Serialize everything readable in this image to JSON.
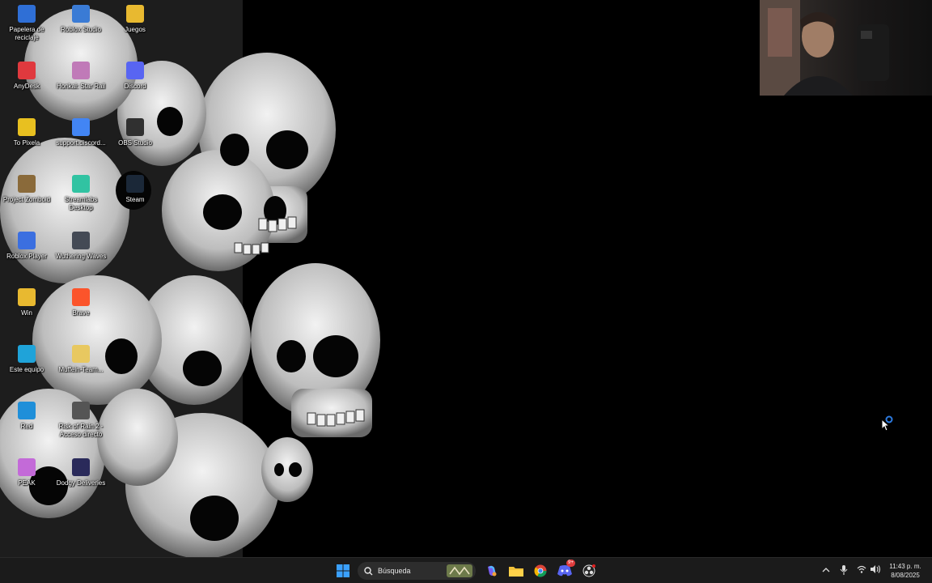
{
  "desktop": {
    "icons": [
      {
        "label": "Papelera de reciclaje",
        "icon": "recycle-bin-icon",
        "color": "#2f6fd6"
      },
      {
        "label": "Roblox Studio",
        "icon": "roblox-studio-icon",
        "color": "#3a7bd5"
      },
      {
        "label": "Juegos",
        "icon": "folder-icon",
        "color": "#e8b930"
      },
      {
        "label": "AnyDesk",
        "icon": "anydesk-icon",
        "color": "#e0393e"
      },
      {
        "label": "Honkai: Star Rail",
        "icon": "honkai-star-rail-icon",
        "color": "#c07ab8"
      },
      {
        "label": "Discord",
        "icon": "discord-icon",
        "color": "#5865f2"
      },
      {
        "label": "To Pixela",
        "icon": "to-pixela-icon",
        "color": "#e8c020"
      },
      {
        "label": "support.discord...",
        "icon": "chrome-shortcut-icon",
        "color": "#4285f4"
      },
      {
        "label": "OBS Studio",
        "icon": "obs-studio-icon",
        "color": "#303030"
      },
      {
        "label": "Project Zomboid",
        "icon": "project-zomboid-icon",
        "color": "#8a6a3a"
      },
      {
        "label": "Streamlabs Desktop",
        "icon": "streamlabs-icon",
        "color": "#31c3a2"
      },
      {
        "label": "Steam",
        "icon": "steam-icon",
        "color": "#1b2838"
      },
      {
        "label": "Roblox Player",
        "icon": "roblox-player-icon",
        "color": "#3b6fe0"
      },
      {
        "label": "Wuthering Waves",
        "icon": "wuthering-waves-icon",
        "color": "#444a55"
      },
      {
        "label": "Win",
        "icon": "folder-icon",
        "color": "#e8b930"
      },
      {
        "label": "Brave",
        "icon": "brave-icon",
        "color": "#fb542b"
      },
      {
        "label": "Este equipo",
        "icon": "this-pc-icon",
        "color": "#1fa3d9"
      },
      {
        "label": "Muffein-Team...",
        "icon": "folder-icon",
        "color": "#e8c860"
      },
      {
        "label": "Red",
        "icon": "network-icon",
        "color": "#1f8fd9"
      },
      {
        "label": "Risk of Rain 2 - Acceso directo",
        "icon": "risk-of-rain-icon",
        "color": "#555555"
      },
      {
        "label": "PEAK",
        "icon": "peak-icon",
        "color": "#c36ad8"
      },
      {
        "label": "Dodgy Deliveries",
        "icon": "dodgy-deliveries-icon",
        "color": "#2a2a5a"
      }
    ]
  },
  "taskbar": {
    "search_label": "Búsqueda",
    "discord_badge": "9+",
    "clock_time": "11:43 p. m.",
    "clock_date": "8/08/2025"
  }
}
